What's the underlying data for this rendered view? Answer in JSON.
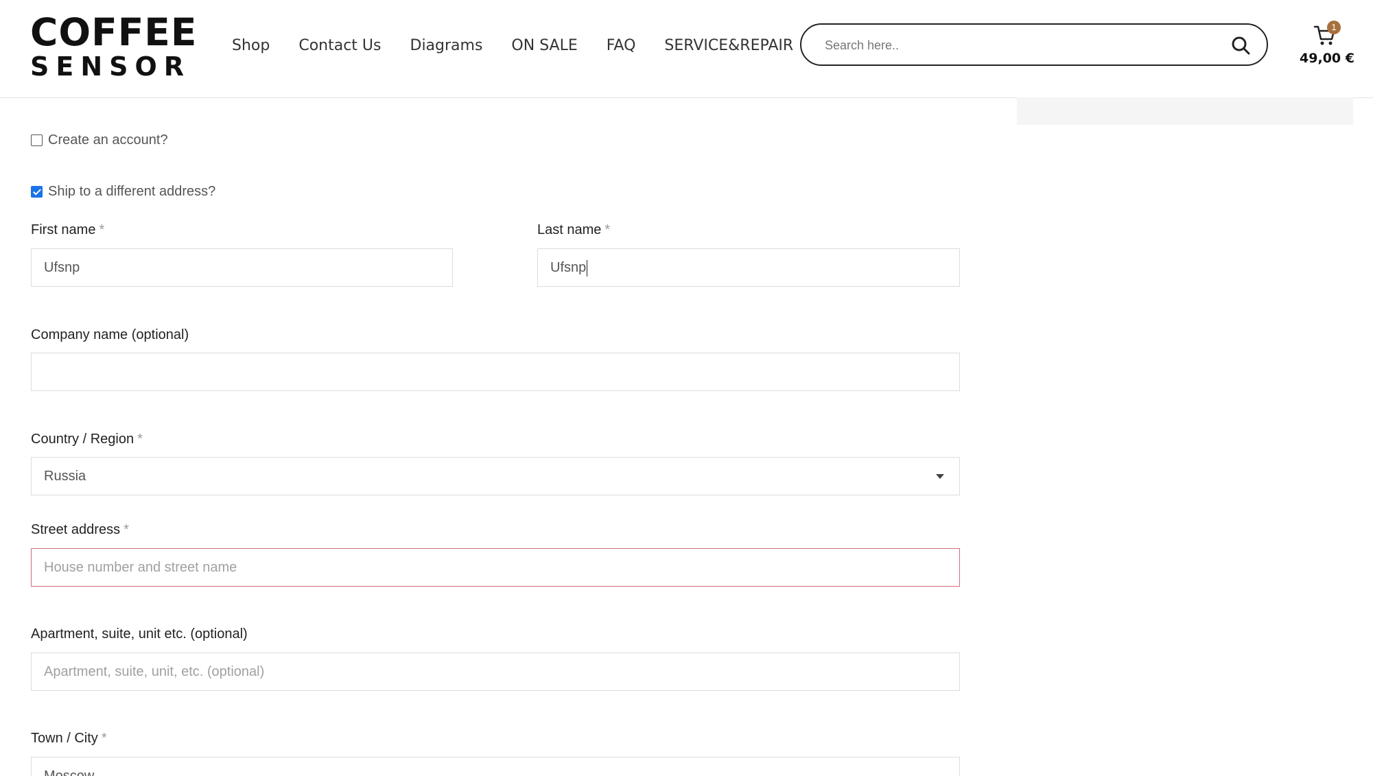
{
  "header": {
    "logo": {
      "line1": "COFFEE",
      "line2": "SENSOR"
    },
    "nav": [
      "Shop",
      "Contact Us",
      "Diagrams",
      "ON SALE",
      "FAQ",
      "SERVICE&REPAIR"
    ],
    "search": {
      "placeholder": "Search here.."
    },
    "cart": {
      "count": "1",
      "total": "49,00 €"
    }
  },
  "form": {
    "create_account": {
      "label": "Create an account?",
      "checked": false
    },
    "ship_different": {
      "label": "Ship to a different address?",
      "checked": true
    },
    "required_mark": "*",
    "first_name": {
      "label": "First name",
      "value": "Ufsnp"
    },
    "last_name": {
      "label": "Last name",
      "value": "Ufsnp"
    },
    "company": {
      "label": "Company name (optional)",
      "value": ""
    },
    "country": {
      "label": "Country / Region",
      "value": "Russia"
    },
    "street": {
      "label": "Street address",
      "placeholder": "House number and street name"
    },
    "apartment": {
      "label": "Apartment, suite, unit etc. (optional)",
      "placeholder": "Apartment, suite, unit, etc. (optional)"
    },
    "city": {
      "label": "Town / City",
      "value": "Moscow"
    }
  },
  "colors": {
    "accent": "#a8703c",
    "checkbox": "#1a73e8",
    "error_border": "#c9707a"
  }
}
